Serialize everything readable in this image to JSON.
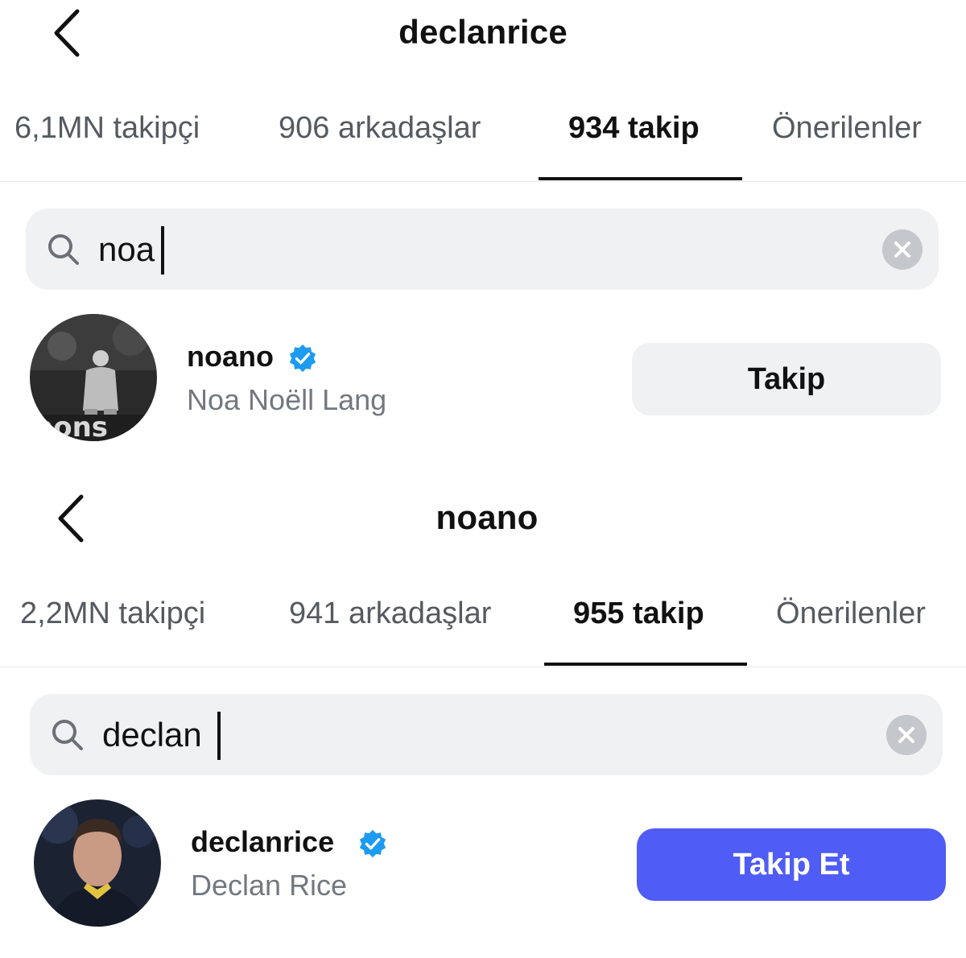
{
  "panels": [
    {
      "title": "declanrice",
      "tabs": [
        {
          "label": "6,1MN takipçi"
        },
        {
          "label": "906 arkadaşlar"
        },
        {
          "label": "934 takip"
        },
        {
          "label": "Önerilenler"
        }
      ],
      "active_tab": "934 takip",
      "search": {
        "value": "noa"
      },
      "result": {
        "username": "noano",
        "full_name": "Noa Noëll Lang",
        "verified": true,
        "button_label": "Takip",
        "avatar_icon": "profile-photo-football-player"
      }
    },
    {
      "title": "noano",
      "tabs": [
        {
          "label": "2,2MN takipçi"
        },
        {
          "label": "941 arkadaşlar"
        },
        {
          "label": "955 takip"
        },
        {
          "label": "Önerilenler"
        }
      ],
      "active_tab": "955 takip",
      "search": {
        "value": "declan"
      },
      "result": {
        "username": "declanrice",
        "full_name": "Declan Rice",
        "verified": true,
        "button_label": "Takip Et",
        "avatar_icon": "profile-photo-football-player"
      }
    }
  ],
  "colors": {
    "follow_blue": "#4f5cf5",
    "button_gray": "#eff1f3",
    "verified_blue": "#1d9bf0",
    "secondary_text": "#737880"
  }
}
